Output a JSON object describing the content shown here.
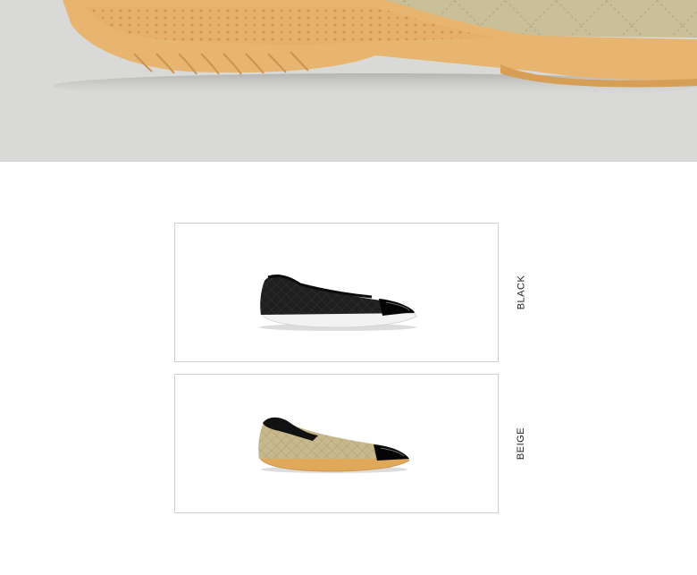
{
  "hero": {
    "image": "beige-quilted-flat-closeup",
    "background_color": "#d9dad8"
  },
  "variants": [
    {
      "id": "black",
      "label": "BLACK",
      "image": "black-quilted-ballet-flat",
      "upper_color": "#1b1b1b",
      "sole_color": "#f2f2f2"
    },
    {
      "id": "beige",
      "label": "BEIGE",
      "image": "beige-quilted-ballet-flat",
      "upper_color": "#c8b98c",
      "sole_color": "#e0a95a"
    }
  ],
  "colors": {
    "card_border": "#cfcfcf",
    "text": "#222222"
  }
}
